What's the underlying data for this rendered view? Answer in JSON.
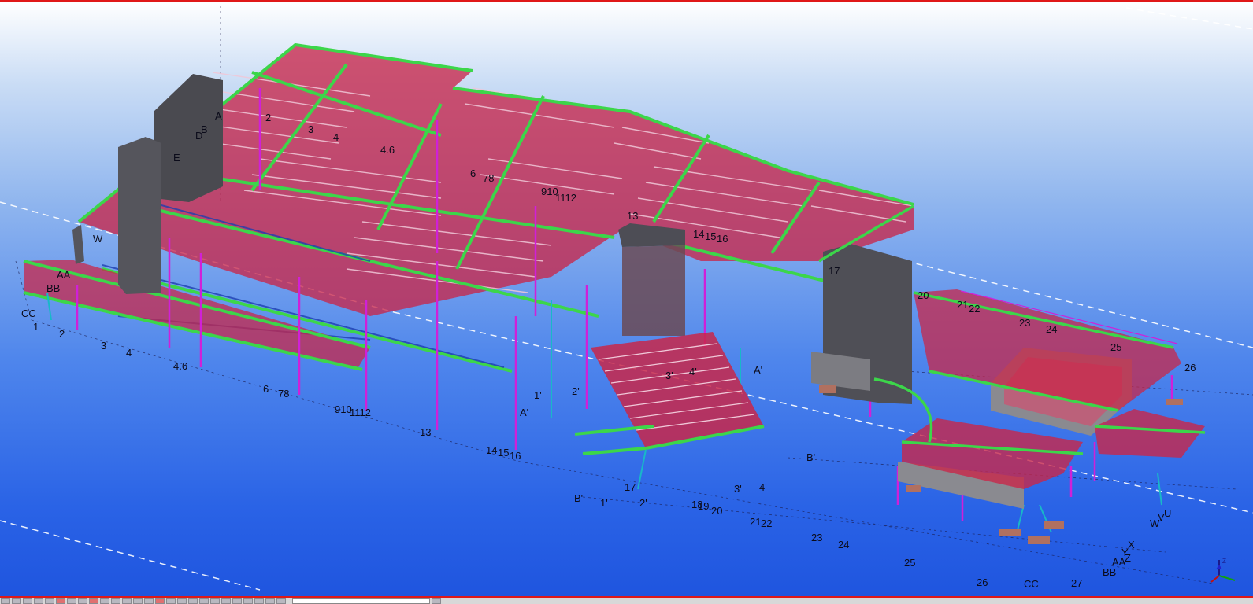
{
  "viewport": {
    "title": "",
    "grid_labels": {
      "front_numbers": [
        "1",
        "2",
        "3",
        "4",
        "4.6",
        "6",
        "78",
        "910",
        "1112",
        "13",
        "14",
        "15",
        "16"
      ],
      "right_numbers": [
        "17",
        "18",
        "19",
        "20",
        "21",
        "22",
        "23",
        "24",
        "25",
        "26",
        "27"
      ],
      "letters_left": [
        "CC",
        "BB",
        "AA",
        "W",
        "E",
        "D",
        "B",
        "A"
      ],
      "letters_front": [
        "A'",
        "B'",
        "1'",
        "2'",
        "3'",
        "4'"
      ],
      "letters_right": [
        "U",
        "V",
        "W",
        "X",
        "Y",
        "Z",
        "AA",
        "BB",
        "CC"
      ]
    }
  },
  "statusbar": {
    "buttons": 28
  },
  "colors": {
    "background_top": "#ffffff",
    "background_bottom": "#1f55df",
    "beam_red": "#c8274a",
    "beam_green": "#3cd64a",
    "column_magenta": "#d020d8",
    "brace_cyan": "#18b8c8",
    "slab_grey": "#4a4a50",
    "frame_border": "#e01818"
  }
}
